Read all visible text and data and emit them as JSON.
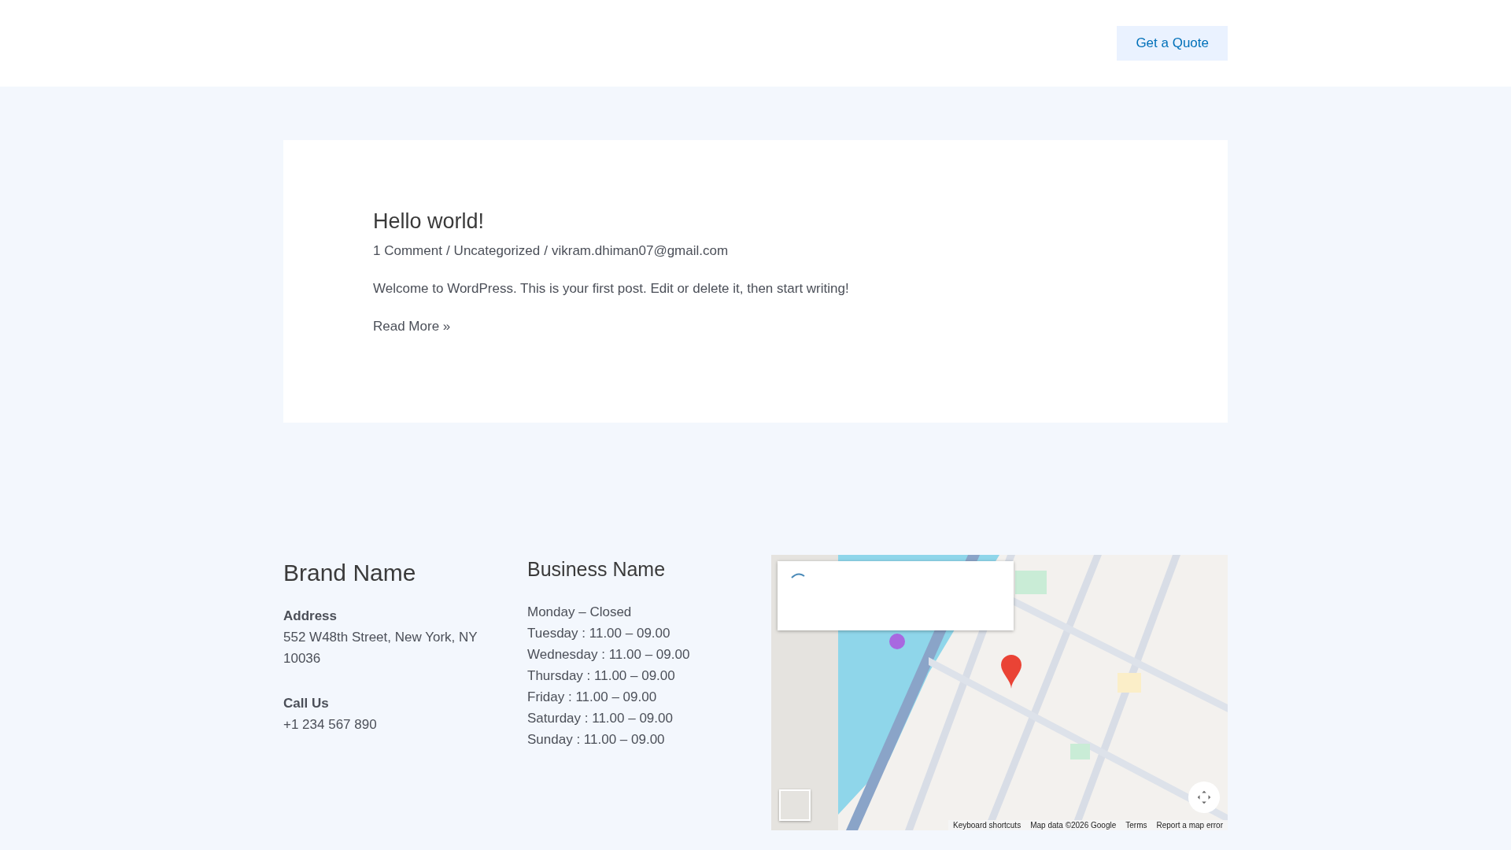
{
  "header": {
    "button": "Get a Quote"
  },
  "post": {
    "title": "Hello world!",
    "meta": [
      "1 Comment",
      "Uncategorized",
      "vikram.dhiman07@gmail.com"
    ],
    "separator": "/",
    "excerpt": "Welcome to WordPress. This is your first post. Edit or delete it, then start writing!",
    "read_more": "Read More »"
  },
  "footer": {
    "brand": {
      "title": "Brand Name",
      "sections": [
        {
          "heading": "Address",
          "text": "552 W48th Street, New York, NY 10036"
        },
        {
          "heading": "Call Us",
          "text": "+1 234 567 890"
        }
      ]
    },
    "business": {
      "title": "Business Name",
      "hours": [
        "Monday – Closed",
        "Tuesday : 11.00 – 09.00",
        "Wednesday : 11.00 – 09.00",
        "Thursday : 11.00 – 09.00",
        "Friday : 11.00 – 09.00",
        "Saturday : 11.00 – 09.00",
        "Sunday : 11.00 – 09.00"
      ]
    },
    "map": {
      "kind": "picture",
      "attribution": [
        "Keyboard shortcuts",
        "Map data ©2026 Google",
        "Terms",
        "Report a map error"
      ]
    }
  }
}
